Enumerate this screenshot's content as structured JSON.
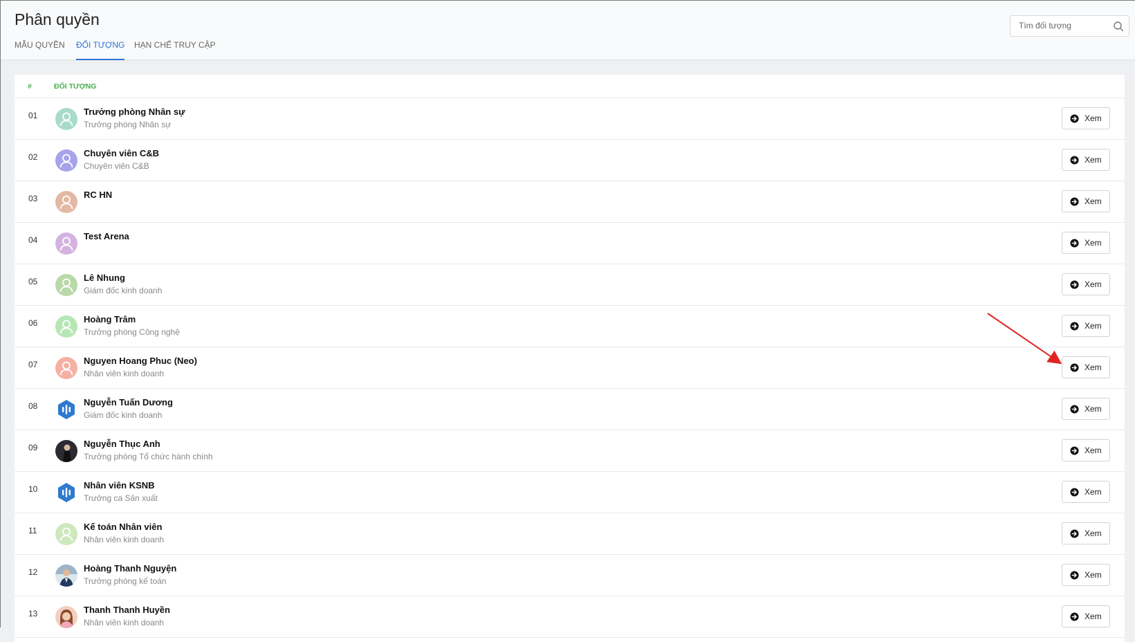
{
  "page": {
    "title": "Phân quyền"
  },
  "tabs": [
    {
      "label": "MẪU QUYỀN",
      "active": false
    },
    {
      "label": "ĐỐI TƯỢNG",
      "active": true
    },
    {
      "label": "HẠN CHẾ TRUY CẬP",
      "active": false
    }
  ],
  "search": {
    "placeholder": "Tìm đối tượng",
    "value": ""
  },
  "table": {
    "headers": {
      "index": "#",
      "object": "ĐỐI TƯỢNG"
    },
    "view_label": "Xem",
    "rows": [
      {
        "index": "01",
        "name": "Trưởng phòng Nhân sự",
        "subtitle": "Trưởng phòng Nhân sự",
        "avatar": "person-placeholder",
        "avatar_color": "#a8dcc8"
      },
      {
        "index": "02",
        "name": "Chuyên viên C&B",
        "subtitle": "Chuyên viên C&B",
        "avatar": "person-placeholder",
        "avatar_color": "#a7a3ea"
      },
      {
        "index": "03",
        "name": "RC HN",
        "subtitle": "",
        "avatar": "person-placeholder",
        "avatar_color": "#e3b9a4"
      },
      {
        "index": "04",
        "name": "Test Arena",
        "subtitle": "",
        "avatar": "person-placeholder",
        "avatar_color": "#d4b3e0"
      },
      {
        "index": "05",
        "name": "Lê Nhung",
        "subtitle": "Giám đốc kinh doanh",
        "avatar": "person-placeholder",
        "avatar_color": "#b9d9a8"
      },
      {
        "index": "06",
        "name": "Hoàng Trâm",
        "subtitle": "Trưởng phòng Công nghệ",
        "avatar": "person-placeholder",
        "avatar_color": "#b7e6b5"
      },
      {
        "index": "07",
        "name": "Nguyen Hoang Phuc (Neo)",
        "subtitle": "Nhân viên kinh doanh",
        "avatar": "person-placeholder",
        "avatar_color": "#f5b0a3"
      },
      {
        "index": "08",
        "name": "Nguyễn Tuấn Dương",
        "subtitle": "Giám đốc kinh doanh",
        "avatar": "hexagon-logo",
        "avatar_color": "#2f7ad0"
      },
      {
        "index": "09",
        "name": "Nguyễn Thục Anh",
        "subtitle": "Trưởng phòng Tổ chức hành chính",
        "avatar": "photo-dark",
        "avatar_color": "#2a2a30"
      },
      {
        "index": "10",
        "name": "Nhân viên KSNB",
        "subtitle": "Trưởng ca Sản xuất",
        "avatar": "hexagon-logo",
        "avatar_color": "#2f7ad0"
      },
      {
        "index": "11",
        "name": "Kế toán Nhân viên",
        "subtitle": "Nhân viên kinh doanh",
        "avatar": "person-placeholder",
        "avatar_color": "#cde8bd"
      },
      {
        "index": "12",
        "name": "Hoàng Thanh Nguyện",
        "subtitle": "Trưởng phòng kế toán",
        "avatar": "photo-man",
        "avatar_color": "#9fb4c8"
      },
      {
        "index": "13",
        "name": "Thanh Thanh Huyền",
        "subtitle": "Nhân viên kinh doanh",
        "avatar": "photo-woman",
        "avatar_color": "#f3cfc0"
      }
    ]
  },
  "annotation": {
    "arrow_color": "#e02424"
  }
}
